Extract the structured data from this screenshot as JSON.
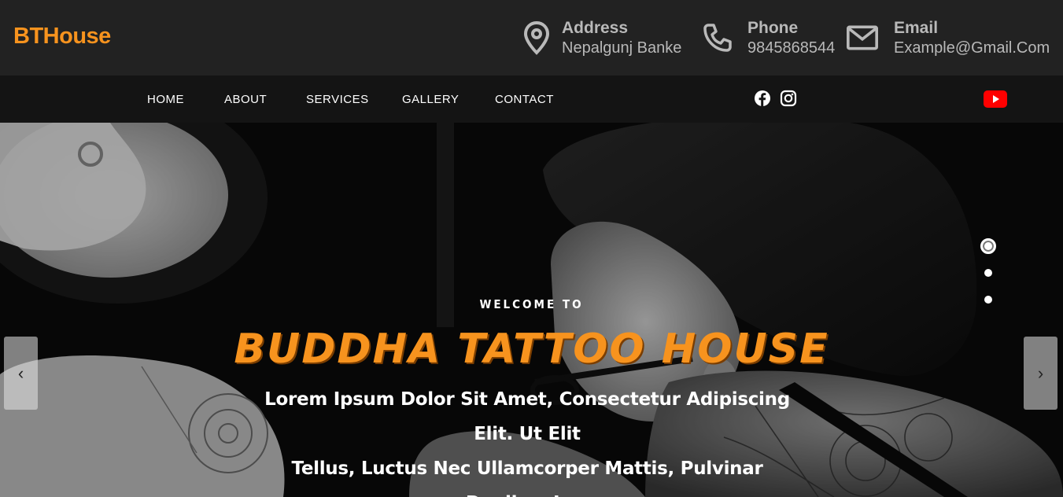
{
  "brand": {
    "name": "BTHouse",
    "color": "#f7931e"
  },
  "contact": {
    "address": {
      "label": "Address",
      "value": "Nepalgunj Banke",
      "icon": "map-pin-icon"
    },
    "phone": {
      "label": "Phone",
      "value": "9845868544",
      "icon": "phone-icon"
    },
    "email": {
      "label": "Email",
      "value": "Example@Gmail.Com",
      "icon": "mail-icon"
    }
  },
  "nav": {
    "items": [
      {
        "label": "HOME"
      },
      {
        "label": "ABOUT"
      },
      {
        "label": "SERVICES"
      },
      {
        "label": "GALLERY"
      },
      {
        "label": "CONTACT"
      }
    ],
    "social": [
      "facebook-icon",
      "instagram-icon",
      "youtube-icon"
    ]
  },
  "hero": {
    "welcome": "WELCOME TO",
    "title": "BUDDHA TATTOO HOUSE",
    "subtitle_line1": "Lorem Ipsum Dolor Sit Amet, Consectetur Adipiscing Elit. Ut Elit",
    "subtitle_line2": "Tellus, Luctus Nec Ullamcorper Mattis, Pulvinar Dapibus Leo",
    "prev_arrow": "‹",
    "next_arrow": "›",
    "slides": 3,
    "active_slide": 1
  },
  "colors": {
    "accent": "#f7931e",
    "topbar": "#222222",
    "navbar": "#141414",
    "youtube": "#ff0000"
  }
}
